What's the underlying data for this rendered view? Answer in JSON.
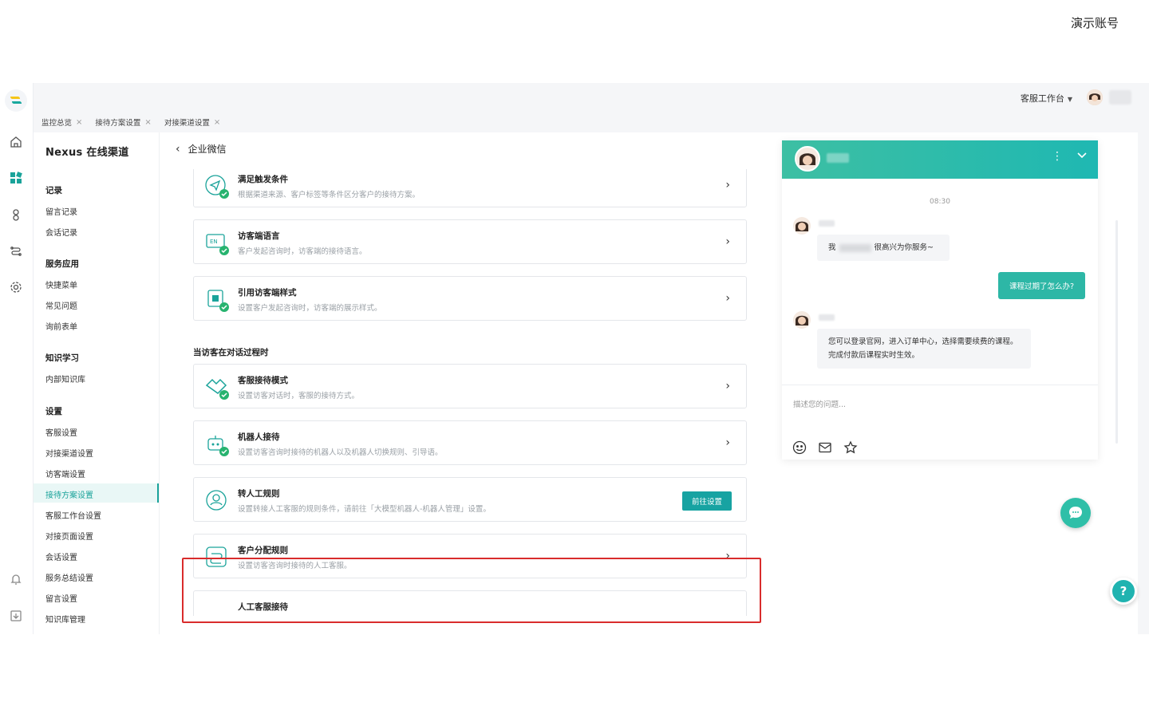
{
  "demo_account": "演示账号",
  "topbar": {
    "workbench": "客服工作台"
  },
  "tabs": [
    {
      "label": "监控总览"
    },
    {
      "label": "接待方案设置"
    },
    {
      "label": "对接渠道设置"
    }
  ],
  "subnav": {
    "title": "Nexus 在线渠道",
    "groups": [
      {
        "label": "记录",
        "items": [
          "留言记录",
          "会话记录"
        ]
      },
      {
        "label": "服务应用",
        "items": [
          "快捷菜单",
          "常见问题",
          "询前表单"
        ]
      },
      {
        "label": "知识学习",
        "items": [
          "内部知识库"
        ]
      },
      {
        "label": "设置",
        "items": [
          "客服设置",
          "对接渠道设置",
          "访客端设置",
          "接待方案设置",
          "客服工作台设置",
          "对接页面设置",
          "会话设置",
          "服务总结设置",
          "留言设置",
          "知识库管理"
        ]
      }
    ],
    "active": "接待方案设置"
  },
  "main": {
    "back_title": "企业微信",
    "cards_top": [
      {
        "title": "满足触发条件",
        "desc": "根据渠道来源、客户标签等条件区分客户的接待方案。"
      },
      {
        "title": "访客端语言",
        "desc": "客户发起咨询时，访客端的接待语言。"
      },
      {
        "title": "引用访客端样式",
        "desc": "设置客户发起咨询时，访客端的展示样式。"
      }
    ],
    "section_title": "当访客在对话过程时",
    "cards_bottom": [
      {
        "title": "客服接待模式",
        "desc": "设置访客对话时，客服的接待方式。"
      },
      {
        "title": "机器人接待",
        "desc": "设置访客咨询时接待的机器人以及机器人切换规则、引导语。"
      },
      {
        "title": "转人工规则",
        "desc": "设置转接人工客服的规则条件，请前往「大模型机器人-机器人管理」设置。",
        "button": "前往设置"
      },
      {
        "title": "客户分配规则",
        "desc": "设置访客咨询时接待的人工客服。"
      },
      {
        "title": "人工客服接待",
        "desc": ""
      }
    ]
  },
  "chat": {
    "time": "08:30",
    "greeting_prefix": "我",
    "greeting_suffix": "很高兴为你服务~",
    "user_msg": "课程过期了怎么办?",
    "reply": "您可以登录官网，进入订单中心，选择需要续费的课程。完成付款后课程实时生效。",
    "input_placeholder": "描述您的问题..."
  },
  "colors": {
    "accent": "#1aa39a",
    "highlight": "#d92c2c"
  }
}
